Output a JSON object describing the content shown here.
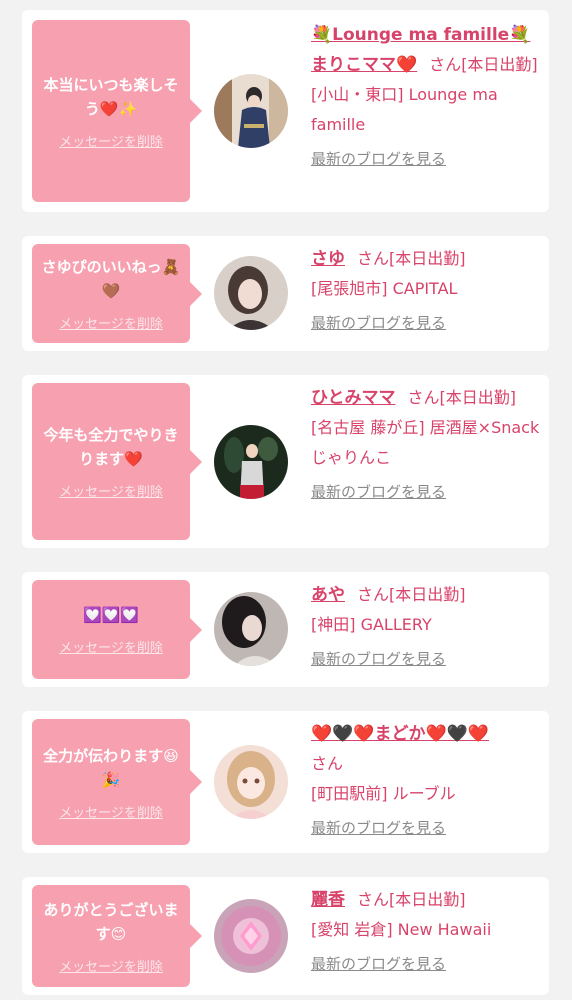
{
  "items": [
    {
      "message": "本当にいつも楽しそう❤️✨",
      "delete_label": "メッセージを削除",
      "name": "💐Lounge ma famille💐まりこママ❤️",
      "san": "さん",
      "status": "[本日出勤]",
      "store": "[小山・東口] Lounge ma famille",
      "blog_label": "最新のブログを見る"
    },
    {
      "message": "さゆぴのいいねっ🧸🤎",
      "delete_label": "メッセージを削除",
      "name": "さゆ",
      "san": "さん",
      "status": "[本日出勤]",
      "store": "[尾張旭市] CAPITAL",
      "blog_label": "最新のブログを見る"
    },
    {
      "message": "今年も全力でやりきります❤️",
      "delete_label": "メッセージを削除",
      "name": "ひとみママ",
      "san": "さん",
      "status": "[本日出勤]",
      "store": "[名古屋 藤が丘] 居酒屋×Snack じゃりんこ",
      "blog_label": "最新のブログを見る"
    },
    {
      "message": "💟💟💟",
      "delete_label": "メッセージを削除",
      "name": "あや",
      "san": "さん",
      "status": "[本日出勤]",
      "store": "[神田] GALLERY",
      "blog_label": "最新のブログを見る"
    },
    {
      "message": "全力が伝わります😆🎉",
      "delete_label": "メッセージを削除",
      "name": "❤️🖤❤️まどか❤️🖤❤️",
      "san": "さん",
      "status": "",
      "store": "[町田駅前] ルーブル",
      "blog_label": "最新のブログを見る"
    },
    {
      "message": "ありがとうございます😊",
      "delete_label": "メッセージを削除",
      "name": "麗香",
      "san": "さん",
      "status": "[本日出勤]",
      "store": "[愛知 岩倉] New Hawaii",
      "blog_label": "最新のブログを見る"
    }
  ]
}
